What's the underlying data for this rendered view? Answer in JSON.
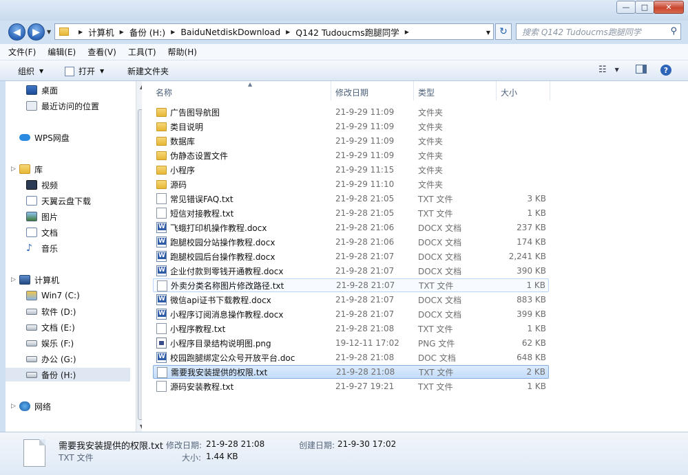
{
  "window": {
    "minimize_label": "—",
    "maximize_label": "□",
    "close_label": "✕"
  },
  "address": {
    "crumbs": [
      "计算机",
      "备份 (H:)",
      "BaiduNetdiskDownload",
      "Q142 Tudoucms跑腿同学"
    ],
    "search_placeholder": "搜索 Q142 Tudoucms跑腿同学"
  },
  "menu": [
    "文件(F)",
    "编辑(E)",
    "查看(V)",
    "工具(T)",
    "帮助(H)"
  ],
  "toolbar": {
    "organize": "组织",
    "open": "打开",
    "new_folder": "新建文件夹"
  },
  "sidebar": {
    "favorites": [
      {
        "label": "桌面",
        "icon": "desktop-icon"
      },
      {
        "label": "最近访问的位置",
        "icon": "recent-places-icon"
      }
    ],
    "wps": {
      "label": "WPS网盘",
      "icon": "cloud-icon"
    },
    "library": {
      "label": "库",
      "items": [
        {
          "label": "视频",
          "icon": "video-library-icon"
        },
        {
          "label": "天翼云盘下载",
          "icon": "document-library-icon"
        },
        {
          "label": "图片",
          "icon": "picture-library-icon"
        },
        {
          "label": "文档",
          "icon": "document-library-icon"
        },
        {
          "label": "音乐",
          "icon": "music-library-icon"
        }
      ]
    },
    "computer": {
      "label": "计算机",
      "drives": [
        {
          "label": "Win7 (C:)",
          "icon": "system-drive-icon"
        },
        {
          "label": "软件 (D:)",
          "icon": "drive-icon"
        },
        {
          "label": "文档 (E:)",
          "icon": "drive-icon"
        },
        {
          "label": "娱乐 (F:)",
          "icon": "drive-icon"
        },
        {
          "label": "办公 (G:)",
          "icon": "drive-icon"
        },
        {
          "label": "备份 (H:)",
          "icon": "drive-icon"
        }
      ]
    },
    "network": {
      "label": "网络",
      "icon": "network-icon"
    }
  },
  "columns": {
    "name": "名称",
    "date": "修改日期",
    "type": "类型",
    "size": "大小"
  },
  "files": [
    {
      "name": "广告图导航图",
      "date": "21-9-29 11:09",
      "type": "文件夹",
      "size": "",
      "icon": "folder"
    },
    {
      "name": "类目说明",
      "date": "21-9-29 11:09",
      "type": "文件夹",
      "size": "",
      "icon": "folder"
    },
    {
      "name": "数据库",
      "date": "21-9-29 11:09",
      "type": "文件夹",
      "size": "",
      "icon": "folder"
    },
    {
      "name": "伪静态设置文件",
      "date": "21-9-29 11:09",
      "type": "文件夹",
      "size": "",
      "icon": "folder"
    },
    {
      "name": "小程序",
      "date": "21-9-29 11:15",
      "type": "文件夹",
      "size": "",
      "icon": "folder"
    },
    {
      "name": "源码",
      "date": "21-9-29 11:10",
      "type": "文件夹",
      "size": "",
      "icon": "folder"
    },
    {
      "name": "常见错误FAQ.txt",
      "date": "21-9-28 21:05",
      "type": "TXT 文件",
      "size": "3 KB",
      "icon": "txt"
    },
    {
      "name": "短信对接教程.txt",
      "date": "21-9-28 21:05",
      "type": "TXT 文件",
      "size": "1 KB",
      "icon": "txt"
    },
    {
      "name": "飞蛾打印机操作教程.docx",
      "date": "21-9-28 21:06",
      "type": "DOCX 文档",
      "size": "237 KB",
      "icon": "docx"
    },
    {
      "name": "跑腿校园分站操作教程.docx",
      "date": "21-9-28 21:06",
      "type": "DOCX 文档",
      "size": "174 KB",
      "icon": "docx"
    },
    {
      "name": "跑腿校园后台操作教程.docx",
      "date": "21-9-28 21:07",
      "type": "DOCX 文档",
      "size": "2,241 KB",
      "icon": "docx"
    },
    {
      "name": "企业付款到零钱开通教程.docx",
      "date": "21-9-28 21:07",
      "type": "DOCX 文档",
      "size": "390 KB",
      "icon": "docx"
    },
    {
      "name": "外卖分类名称图片修改路径.txt",
      "date": "21-9-28 21:07",
      "type": "TXT 文件",
      "size": "1 KB",
      "icon": "txt"
    },
    {
      "name": "微信api证书下载教程.docx",
      "date": "21-9-28 21:07",
      "type": "DOCX 文档",
      "size": "883 KB",
      "icon": "docx"
    },
    {
      "name": "小程序订阅消息操作教程.docx",
      "date": "21-9-28 21:07",
      "type": "DOCX 文档",
      "size": "399 KB",
      "icon": "docx"
    },
    {
      "name": "小程序教程.txt",
      "date": "21-9-28 21:08",
      "type": "TXT 文件",
      "size": "1 KB",
      "icon": "txt"
    },
    {
      "name": "小程序目录结构说明图.png",
      "date": "19-12-11 17:02",
      "type": "PNG 文件",
      "size": "62 KB",
      "icon": "png"
    },
    {
      "name": "校园跑腿绑定公众号开放平台.doc",
      "date": "21-9-28 21:08",
      "type": "DOC 文档",
      "size": "648 KB",
      "icon": "doc"
    },
    {
      "name": "需要我安装提供的权限.txt",
      "date": "21-9-28 21:08",
      "type": "TXT 文件",
      "size": "2 KB",
      "icon": "txt"
    },
    {
      "name": "源码安装教程.txt",
      "date": "21-9-27 19:21",
      "type": "TXT 文件",
      "size": "1 KB",
      "icon": "txt"
    }
  ],
  "details": {
    "name": "需要我安装提供的权限.txt",
    "type": "TXT 文件",
    "modified_label": "修改日期:",
    "modified": "21-9-28 21:08",
    "created_label": "创建日期:",
    "created": "21-9-30 17:02",
    "size_label": "大小:",
    "size": "1.44 KB"
  }
}
